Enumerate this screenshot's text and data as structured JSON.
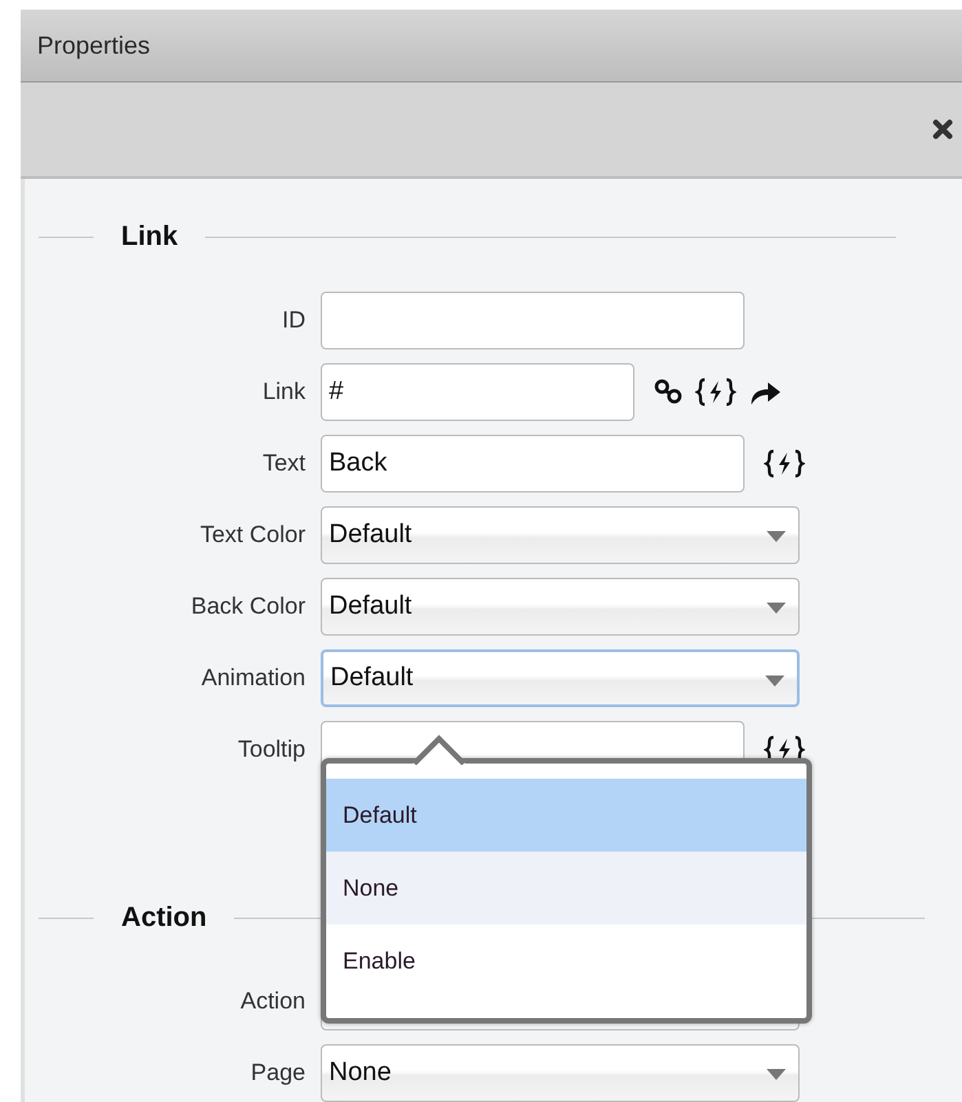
{
  "panel": {
    "title": "Properties"
  },
  "sections": [
    {
      "legend": "Link",
      "fields": [
        {
          "label": "ID",
          "kind": "text"
        },
        {
          "label": "Link",
          "kind": "link",
          "value": "#"
        },
        {
          "label": "Text",
          "kind": "bindable",
          "value": "Back"
        },
        {
          "label": "Text Color",
          "kind": "select",
          "value": "Default",
          "focused": false
        },
        {
          "label": "Back Color",
          "kind": "select",
          "value": "Default",
          "focused": false
        },
        {
          "label": "Animation",
          "kind": "select",
          "value": "Default",
          "focused": true,
          "menu": [
            {
              "label": "Default",
              "selected": true,
              "hovered": false
            },
            {
              "label": "None",
              "selected": false,
              "hovered": true
            },
            {
              "label": "Enable",
              "selected": false,
              "hovered": false
            }
          ]
        },
        {
          "label": "Tooltip",
          "kind": "bindable"
        }
      ]
    },
    {
      "legend": "Action",
      "fields": [
        {
          "label": "Action",
          "kind": "select",
          "focused": false
        },
        {
          "label": "Page",
          "kind": "select",
          "value": "None",
          "focused": false
        }
      ]
    }
  ]
}
